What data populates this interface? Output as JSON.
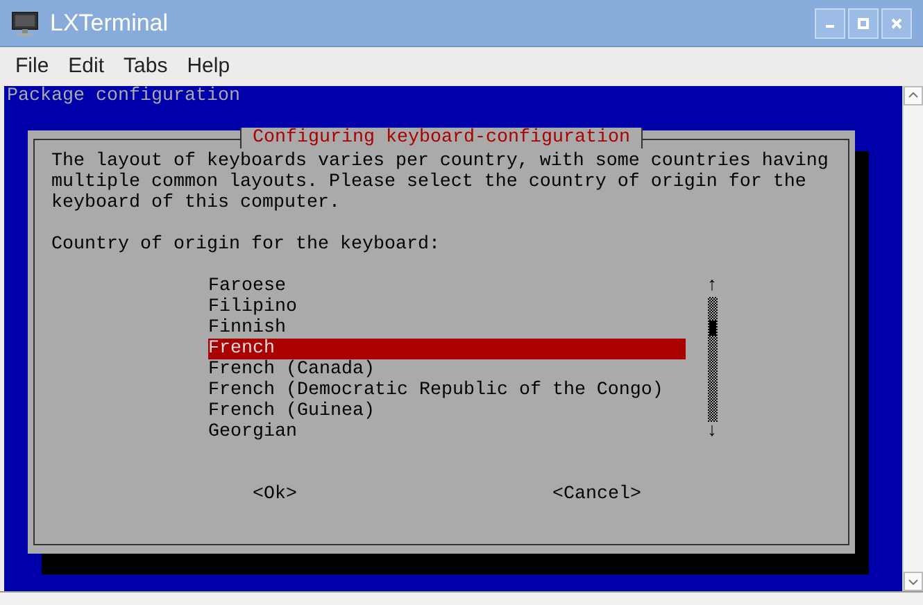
{
  "window": {
    "title": "LXTerminal"
  },
  "menu": [
    "File",
    "Edit",
    "Tabs",
    "Help"
  ],
  "terminal": {
    "header": "Package configuration",
    "dialog": {
      "title": "Configuring keyboard-configuration",
      "description": "The layout of keyboards varies per country, with some countries having multiple common layouts. Please select the country of origin for the keyboard of this computer.",
      "prompt": "Country of origin for the keyboard:",
      "options": [
        {
          "label": "Faroese",
          "selected": false
        },
        {
          "label": "Filipino",
          "selected": false
        },
        {
          "label": "Finnish",
          "selected": false
        },
        {
          "label": "French",
          "selected": true
        },
        {
          "label": "French (Canada)",
          "selected": false
        },
        {
          "label": "French (Democratic Republic of the Congo)",
          "selected": false
        },
        {
          "label": "French (Guinea)",
          "selected": false
        },
        {
          "label": "Georgian",
          "selected": false
        }
      ],
      "scroll_up": "↑",
      "scroll_down": "↓",
      "buttons": [
        "<Ok>",
        "<Cancel>"
      ]
    }
  }
}
